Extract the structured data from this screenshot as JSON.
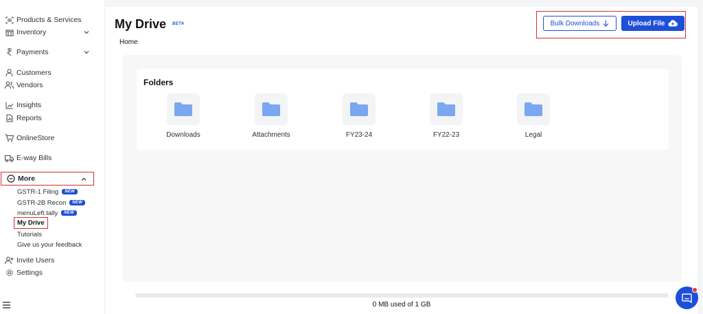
{
  "sidebar": {
    "items": [
      {
        "label": "Products & Services",
        "icon": "barcode-icon"
      },
      {
        "label": "Inventory",
        "icon": "warehouse-icon"
      },
      {
        "label": "Payments",
        "icon": "rupee-icon"
      },
      {
        "label": "Customers",
        "icon": "user-icon"
      },
      {
        "label": "Vendors",
        "icon": "users-icon"
      },
      {
        "label": "Insights",
        "icon": "chart-icon"
      },
      {
        "label": "Reports",
        "icon": "report-icon"
      },
      {
        "label": "OnlineStore",
        "icon": "cart-icon"
      },
      {
        "label": "E-way Bills",
        "icon": "truck-icon"
      },
      {
        "label": "More",
        "icon": "minus-circle-icon"
      }
    ],
    "more_items": [
      {
        "label": "GSTR-1 Filing",
        "badge": "NEW"
      },
      {
        "label": "GSTR-2B Recon",
        "badge": "NEW"
      },
      {
        "label": "menuLeft.tally",
        "badge": "NEW"
      },
      {
        "label": "My Drive"
      },
      {
        "label": "Tutorials"
      },
      {
        "label": "Give us your feedback"
      }
    ],
    "bottom_items": [
      {
        "label": "Invite Users",
        "icon": "user-plus-icon"
      },
      {
        "label": "Settings",
        "icon": "gear-icon"
      }
    ]
  },
  "header": {
    "title": "My Drive",
    "badge": "BETA",
    "breadcrumb": "Home",
    "bulk_downloads_label": "Bulk Downloads",
    "upload_label": "Upload File"
  },
  "folders": {
    "title": "Folders",
    "items": [
      "Downloads",
      "Attachments",
      "FY23-24",
      "FY22-23",
      "Legal"
    ]
  },
  "storage": {
    "text": "0 MB used of 1 GB",
    "used_fraction": 0
  },
  "colors": {
    "accent": "#1e4fd8",
    "highlight": "#d32f2f",
    "folder": "#7aa7f0"
  }
}
